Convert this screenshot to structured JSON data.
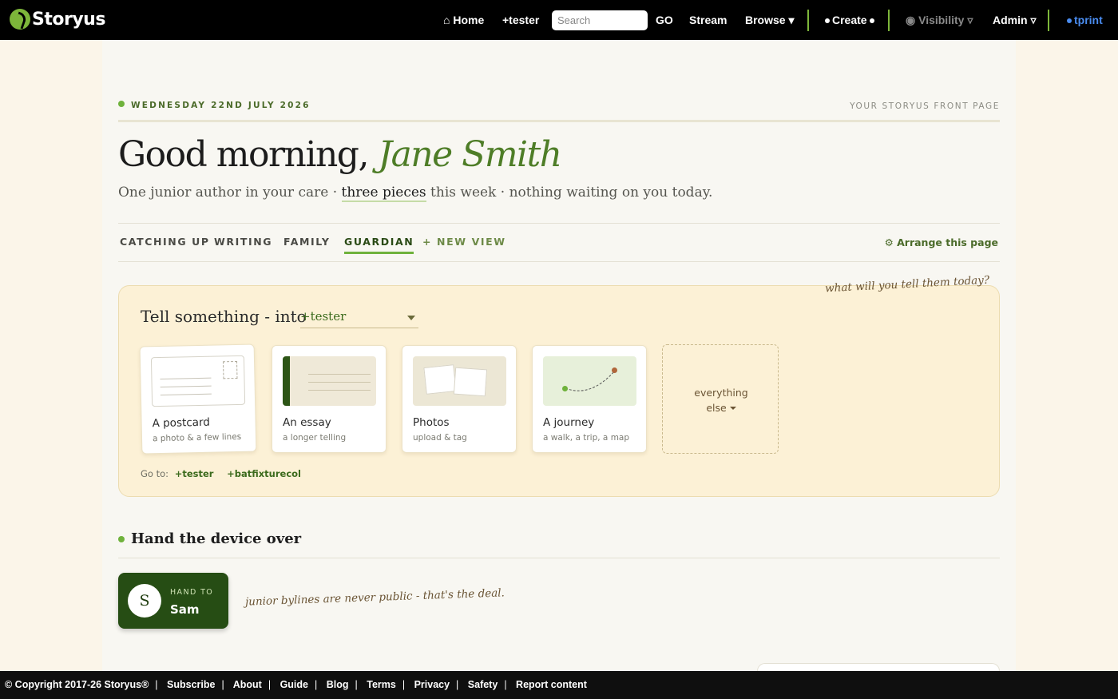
{
  "nav": {
    "brand": "Storyus",
    "home": "⌂ Home",
    "tester": "+tester",
    "search_placeholder": "Search",
    "go": "GO",
    "stream": "Stream",
    "browse": "Browse ▾",
    "create": "Create",
    "visibility": "Visibility ▿",
    "admin": "Admin ▿",
    "user": "tprint"
  },
  "header": {
    "date": "WEDNESDAY 22ND JULY 2026",
    "front_page": "YOUR STORYUS FRONT PAGE",
    "greeting": "Good morning,",
    "name": "Jane Smith",
    "sub_part1": "One junior author in your care · ",
    "sub_highlight": "three pieces",
    "sub_part2": " this week · nothing waiting on you today."
  },
  "tabs": {
    "items": [
      "CATCHING UP",
      "WRITING",
      "FAMILY",
      "GUARDIAN",
      "+ NEW VIEW"
    ],
    "active": "GUARDIAN",
    "arrange": "⚙ Arrange this page"
  },
  "compose": {
    "scribble": "what will you tell them today?",
    "tell": "Tell something - into",
    "into_value": "+tester",
    "tiles": [
      {
        "title": "A postcard",
        "sub": "a photo & a few lines"
      },
      {
        "title": "An essay",
        "sub": "a longer telling"
      },
      {
        "title": "Photos",
        "sub": "upload & tag"
      },
      {
        "title": "A journey",
        "sub": "a walk, a trip, a map"
      }
    ],
    "else_line1": "everything",
    "else_line2": "else",
    "goto_label": "Go to:",
    "goto_links": [
      "+tester",
      "+batfixturecol"
    ]
  },
  "hand": {
    "title": "Hand the device over",
    "avatar": "S",
    "hand_to": "HAND TO",
    "name": "Sam",
    "note": "junior bylines are never public - that's the deal."
  },
  "footer": {
    "copyright": "© Copyright 2017-26 Storyus®",
    "links": [
      "Subscribe",
      "About",
      "Guide",
      "Blog",
      "Terms",
      "Privacy",
      "Safety",
      "Report content"
    ]
  },
  "colors": {
    "accent_green": "#6fb23c",
    "dark_green": "#264d14",
    "name_green": "#4e7d27",
    "compose_bg": "#fcf1d6",
    "link_blue": "#4a8cf0"
  }
}
